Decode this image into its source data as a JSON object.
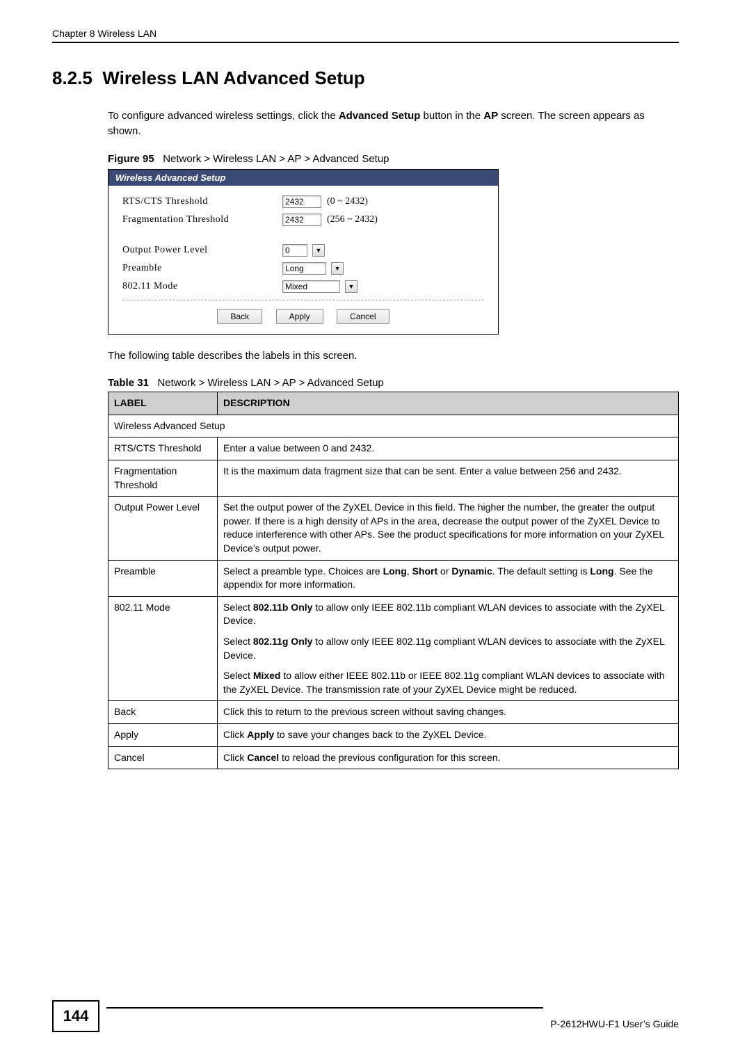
{
  "running_head": "Chapter 8 Wireless LAN",
  "section_number": "8.2.5",
  "section_title": "Wireless LAN Advanced Setup",
  "intro_text": "To configure advanced wireless settings, click the ",
  "intro_bold1": "Advanced Setup",
  "intro_mid1": " button in the ",
  "intro_bold2": "AP",
  "intro_tail": " screen. The screen appears as shown.",
  "figure_label": "Figure 95",
  "figure_caption": "Network > Wireless LAN > AP > Advanced Setup",
  "figure": {
    "header": "Wireless Advanced Setup",
    "rts_label": "RTS/CTS  Threshold",
    "rts_value": "2432",
    "rts_range": "(0 ~ 2432)",
    "frag_label": "Fragmentation  Threshold",
    "frag_value": "2432",
    "frag_range": "(256 ~ 2432)",
    "opl_label": "Output Power Level",
    "opl_value": "0",
    "preamble_label": "Preamble",
    "preamble_value": "Long",
    "mode_label": "802.11 Mode",
    "mode_value": "Mixed",
    "btn_back": "Back",
    "btn_apply": "Apply",
    "btn_cancel": "Cancel"
  },
  "after_figure_text": "The following table describes the labels in this screen.",
  "table_label": "Table 31",
  "table_caption": "Network > Wireless LAN > AP > Advanced Setup",
  "table": {
    "head_label": "LABEL",
    "head_desc": "DESCRIPTION",
    "span_row": "Wireless Advanced Setup",
    "rows": [
      {
        "label": "RTS/CTS Threshold",
        "desc": "Enter a value between 0 and 2432."
      },
      {
        "label": "Fragmentation Threshold",
        "desc": "It is the maximum data fragment size that can be sent. Enter a value between 256 and 2432."
      },
      {
        "label": "Output Power Level",
        "desc": "Set the output power of the ZyXEL Device in this field. The higher the number, the greater the output power. If there is a high density of APs in the area, decrease the output power of the ZyXEL Device to reduce interference with other APs. See the product specifications for more information on your ZyXEL Device’s output power."
      },
      {
        "label": "Preamble",
        "desc_pre": "Select a preamble type. Choices are ",
        "b1": "Long",
        "sep1": ", ",
        "b2": "Short",
        "sep2": " or ",
        "b3": "Dynamic",
        "mid": ". The default setting is ",
        "b4": "Long",
        "tail": ". See the appendix for more information."
      },
      {
        "label": "802.11 Mode",
        "p1_pre": "Select ",
        "p1_b": "802.11b Only",
        "p1_tail": " to allow only IEEE 802.11b compliant WLAN devices to associate with the ZyXEL Device.",
        "p2_pre": "Select ",
        "p2_b": "802.11g Only",
        "p2_tail": " to allow only IEEE 802.11g compliant WLAN devices to associate with the ZyXEL Device.",
        "p3_pre": "Select ",
        "p3_b": "Mixed",
        "p3_tail": " to allow either IEEE 802.11b or IEEE 802.11g compliant WLAN devices to associate with the ZyXEL Device. The transmission rate of your ZyXEL Device might be reduced."
      },
      {
        "label": "Back",
        "desc": "Click this to return to the previous screen without saving changes."
      },
      {
        "label": "Apply",
        "desc_pre": "Click ",
        "b1": "Apply",
        "desc_tail": " to save your changes back to the ZyXEL Device."
      },
      {
        "label": "Cancel",
        "desc_pre": "Click ",
        "b1": "Cancel",
        "desc_tail": " to reload the previous configuration for this screen."
      }
    ]
  },
  "page_number": "144",
  "footer_right": "P-2612HWU-F1 User’s Guide"
}
